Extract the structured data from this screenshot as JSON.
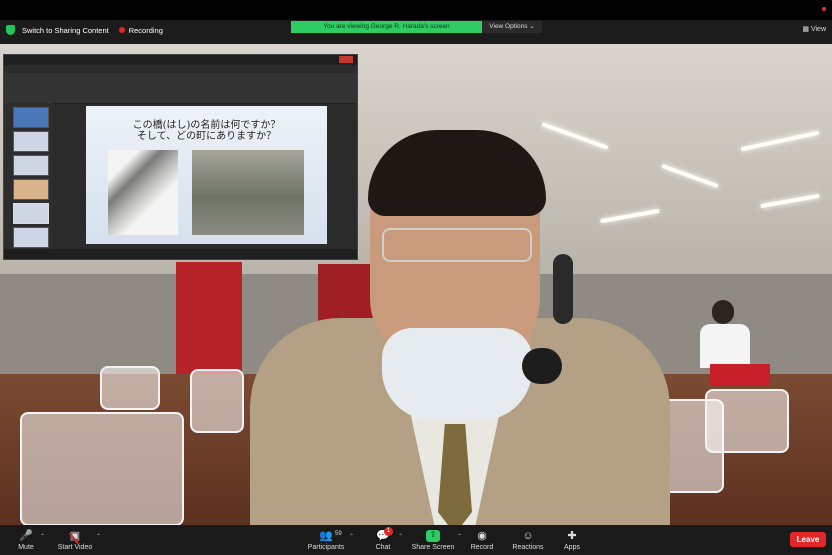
{
  "meeting": {
    "share_switch_label": "Switch to Sharing Content",
    "recording_label": "Recording",
    "viewing_banner": "You are viewing George R. Harada's screen",
    "view_options_label": "View Options ⌄",
    "view_label": "View"
  },
  "shared_slide": {
    "title_line1": "この橋(はし)の名前は何ですか？",
    "title_line2": "そして、どの町にありますか？"
  },
  "toolbar": {
    "mute": "Mute",
    "start_video": "Start Video",
    "participants": "Participants",
    "participants_count": "59",
    "chat": "Chat",
    "chat_badge": "1",
    "share_screen": "Share Screen",
    "record": "Record",
    "reactions": "Reactions",
    "apps": "Apps",
    "leave": "Leave"
  },
  "colors": {
    "share_green": "#2fcb63",
    "leave_red": "#e02828",
    "recording_red": "#e02828"
  }
}
